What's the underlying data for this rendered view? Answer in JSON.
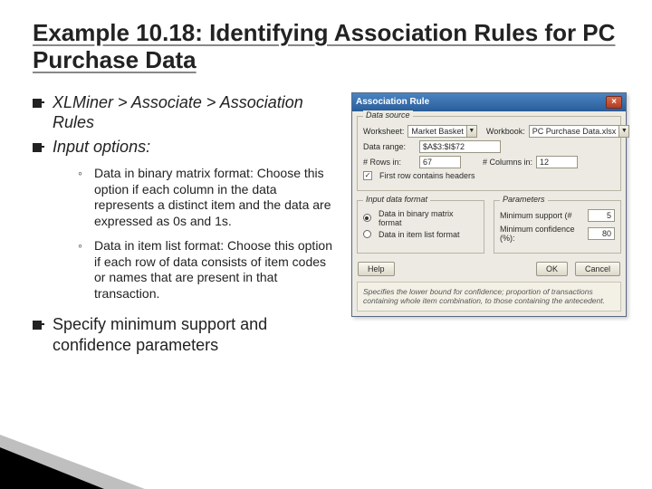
{
  "title": "Example 10.18: Identifying Association Rules for PC Purchase Data",
  "bullets": {
    "b1": "XLMiner > Associate > Association Rules",
    "b2": "Input options:",
    "sub1": "Data in binary matrix format: Choose this option if each column in the data represents a distinct item and the data are expressed as 0s and 1s.",
    "sub2": "Data in item list format: Choose this option if each row of data consists of item codes or names that are present in that transaction.",
    "b3": "Specify minimum support and confidence parameters"
  },
  "dlg": {
    "title": "Association Rule",
    "close": "×",
    "grp_data": "Data source",
    "worksheet_lbl": "Worksheet:",
    "worksheet_val": "Market Basket",
    "workbook_lbl": "Workbook:",
    "workbook_val": "PC Purchase Data.xlsx",
    "range_lbl": "Data range:",
    "range_val": "$A$3:$I$72",
    "rows_lbl": "# Rows in:",
    "rows_val": "67",
    "cols_lbl": "# Columns in:",
    "cols_val": "12",
    "headers_chk": "✓",
    "headers_lbl": "First row contains headers",
    "grp_fmt": "Input data format",
    "radio1": "Data in binary matrix format",
    "radio2": "Data in item list format",
    "grp_param": "Parameters",
    "supp_lbl": "Minimum support (#",
    "supp_val": "5",
    "conf_lbl": "Minimum confidence (%):",
    "conf_val": "80",
    "help": "Help",
    "ok": "OK",
    "cancel": "Cancel",
    "hint": "Specifies the lower bound for confidence; proportion of transactions containing whole item combination, to those containing the antecedent."
  }
}
